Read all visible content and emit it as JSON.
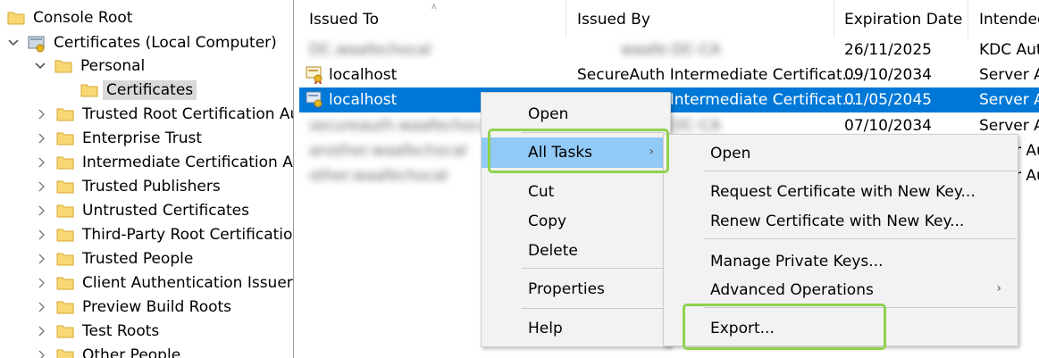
{
  "tree": {
    "root": "Console Root",
    "computer": "Certificates (Local Computer)",
    "personal": "Personal",
    "certificates": "Certificates",
    "stores": [
      "Trusted Root Certification Aut",
      "Enterprise Trust",
      "Intermediate Certification Aut",
      "Trusted Publishers",
      "Untrusted Certificates",
      "Third-Party Root Certification",
      "Trusted People",
      "Client Authentication Issuers",
      "Preview Build Roots",
      "Test Roots",
      "Other People"
    ]
  },
  "list": {
    "columns": [
      "Issued To",
      "Issued By",
      "Expiration Date",
      "Intendec"
    ],
    "rows": [
      {
        "issued_to": "DC.waafechocal",
        "issued_by": "waafe-DC-CA",
        "expiration": "26/11/2025",
        "purpose": "KDC Auth"
      },
      {
        "issued_to": "localhost",
        "issued_by": "SecureAuth Intermediate Certificat...",
        "expiration": "09/10/2034",
        "purpose": "Server Au"
      },
      {
        "issued_to": "localhost",
        "issued_by": "SecureAuth Intermediate Certificat...",
        "expiration": "01/05/2045",
        "purpose": "Server Au"
      },
      {
        "issued_to": "secureauth.waafechocal",
        "issued_by": "waafe-DC-CA",
        "expiration": "07/10/2034",
        "purpose": "Server Au"
      },
      {
        "issued_to": "another.waafechocal",
        "issued_by": "",
        "expiration": "",
        "purpose": "r Au"
      },
      {
        "issued_to": "other.waafechocal",
        "issued_by": "",
        "expiration": "",
        "purpose": "r Au"
      }
    ]
  },
  "context_menu": {
    "open": "Open",
    "all_tasks": "All Tasks",
    "cut": "Cut",
    "copy": "Copy",
    "delete": "Delete",
    "properties": "Properties",
    "help": "Help"
  },
  "submenu": {
    "open": "Open",
    "request": "Request Certificate with New Key...",
    "renew": "Renew Certificate with New Key...",
    "manage_keys": "Manage Private Keys...",
    "advanced": "Advanced Operations",
    "export": "Export..."
  },
  "colors": {
    "selection": "#0078d7",
    "menu_hover": "#91c9f7",
    "highlight": "#8fd14f",
    "folder": "#f8d775"
  }
}
